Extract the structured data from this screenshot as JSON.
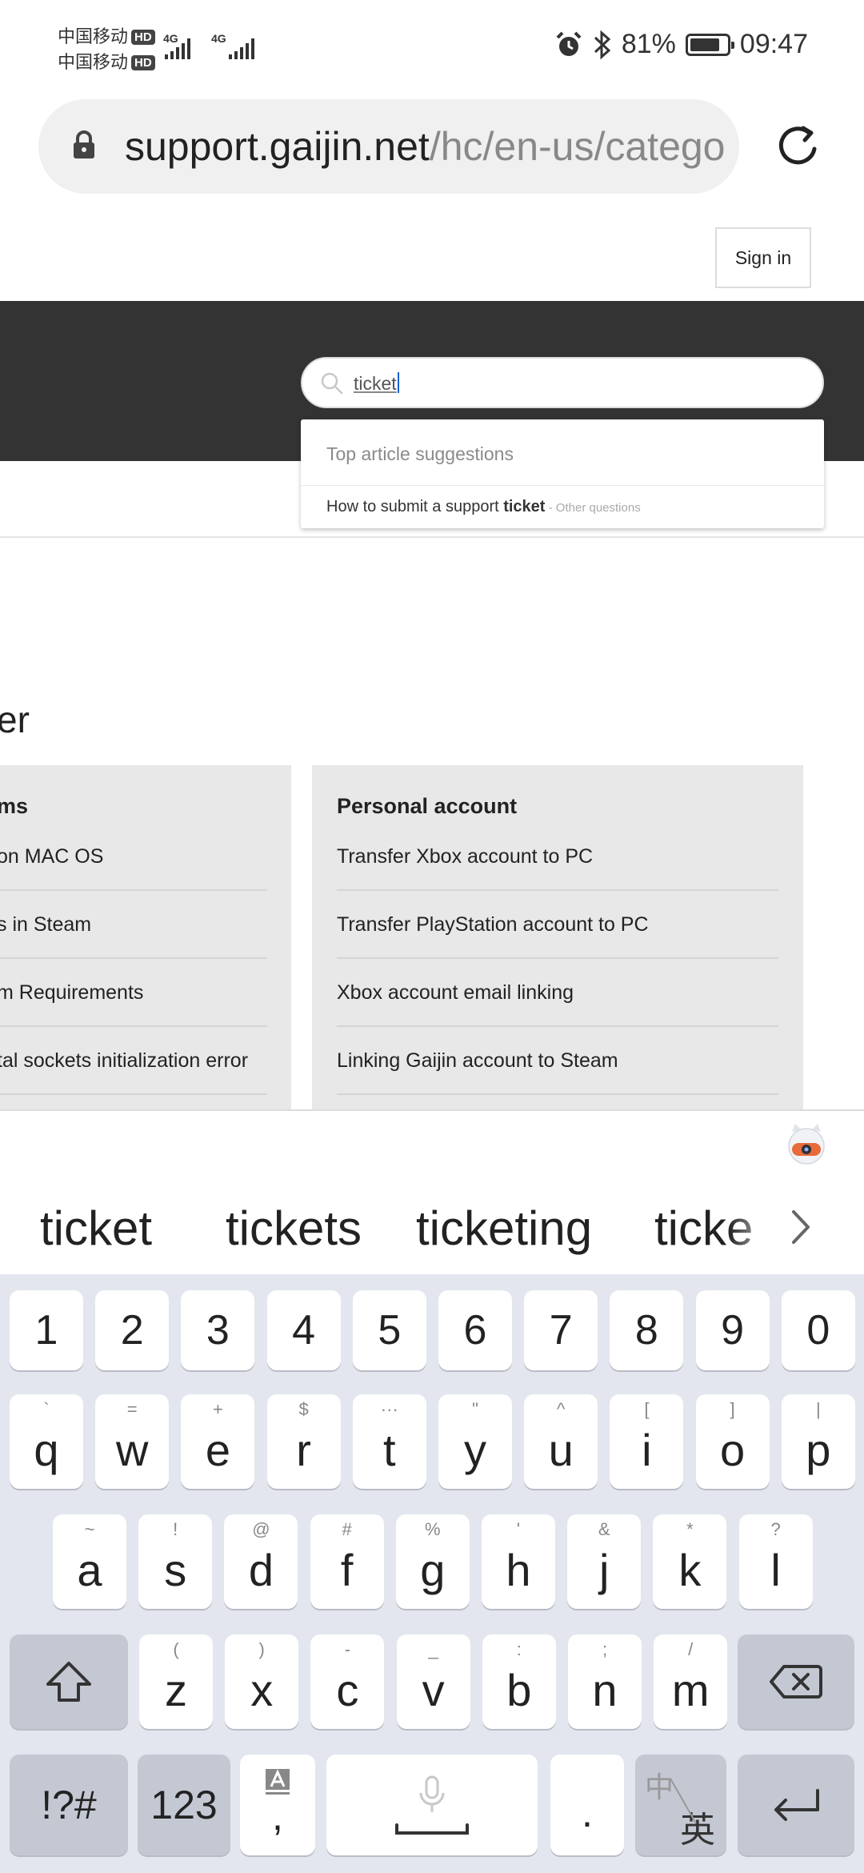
{
  "status_bar": {
    "carrier1": "中国移动",
    "carrier2": "中国移动",
    "hd": "HD",
    "net1": "4G",
    "net2": "4G",
    "battery_pct": "81%",
    "battery_level": 0.81,
    "time": "09:47"
  },
  "browser": {
    "url_host": "support.gaijin.net",
    "url_path": "/hc/en-us/catego"
  },
  "site": {
    "sign_in": "Sign in",
    "search_value": "ticket",
    "suggestions": {
      "header": "Top article suggestions",
      "item_prefix": "How to submit a support ",
      "item_match": "ticket",
      "item_category": " - Other questions"
    },
    "section_title": "er",
    "card_left": {
      "title": "ms",
      "links": [
        "on MAC OS",
        "s in Steam",
        "m Requirements",
        "tal sockets initialization error"
      ]
    },
    "card_right": {
      "title": "Personal account",
      "links": [
        "Transfer Xbox account to PC",
        "Transfer PlayStation account to PC",
        "Xbox account email linking",
        "Linking Gaijin account to Steam"
      ]
    }
  },
  "keyboard": {
    "candidates": [
      "ticket",
      "tickets",
      "ticketing",
      "ticke"
    ],
    "numbers": [
      "1",
      "2",
      "3",
      "4",
      "5",
      "6",
      "7",
      "8",
      "9",
      "0"
    ],
    "row1": [
      {
        "k": "q",
        "s": "`"
      },
      {
        "k": "w",
        "s": "="
      },
      {
        "k": "e",
        "s": "+"
      },
      {
        "k": "r",
        "s": "$"
      },
      {
        "k": "t",
        "s": "···"
      },
      {
        "k": "y",
        "s": "\""
      },
      {
        "k": "u",
        "s": "^"
      },
      {
        "k": "i",
        "s": "["
      },
      {
        "k": "o",
        "s": "]"
      },
      {
        "k": "p",
        "s": "|"
      }
    ],
    "row2": [
      {
        "k": "a",
        "s": "~"
      },
      {
        "k": "s",
        "s": "!"
      },
      {
        "k": "d",
        "s": "@"
      },
      {
        "k": "f",
        "s": "#"
      },
      {
        "k": "g",
        "s": "%"
      },
      {
        "k": "h",
        "s": "'"
      },
      {
        "k": "j",
        "s": "&"
      },
      {
        "k": "k",
        "s": "*"
      },
      {
        "k": "l",
        "s": "?"
      }
    ],
    "row3": [
      {
        "k": "z",
        "s": "("
      },
      {
        "k": "x",
        "s": ")"
      },
      {
        "k": "c",
        "s": "-"
      },
      {
        "k": "v",
        "s": "_"
      },
      {
        "k": "b",
        "s": ":"
      },
      {
        "k": "n",
        "s": ";"
      },
      {
        "k": "m",
        "s": "/"
      }
    ],
    "symbols": "!?#",
    "num_switch": "123",
    "comma": ",",
    "period": ".",
    "lang_zh": "中",
    "lang_en": "英"
  }
}
